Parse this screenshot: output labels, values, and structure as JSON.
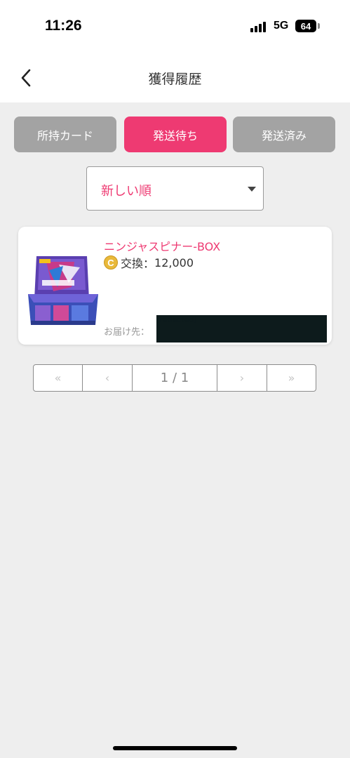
{
  "status_bar": {
    "time": "11:26",
    "network": "5G",
    "battery": "64"
  },
  "header": {
    "title": "獲得履歴",
    "back_icon": "chevron-left-icon"
  },
  "tabs": [
    {
      "label": "所持カード",
      "active": false
    },
    {
      "label": "発送待ち",
      "active": true
    },
    {
      "label": "発送済み",
      "active": false
    }
  ],
  "sort": {
    "selected": "新しい順"
  },
  "items": [
    {
      "name": "ニンジャスピナー-BOX",
      "coin_icon_letter": "C",
      "price_label": "交換：",
      "price": "12,000",
      "ship_label": "お届け先：",
      "ship_value": "[redacted]"
    }
  ],
  "pagination": {
    "first": "«",
    "prev": "‹",
    "current": "1 / 1",
    "next": "›",
    "last": "»"
  },
  "colors": {
    "accent": "#ee3a72",
    "inactive_tab": "#a3a3a3",
    "background": "#eeeeee"
  }
}
